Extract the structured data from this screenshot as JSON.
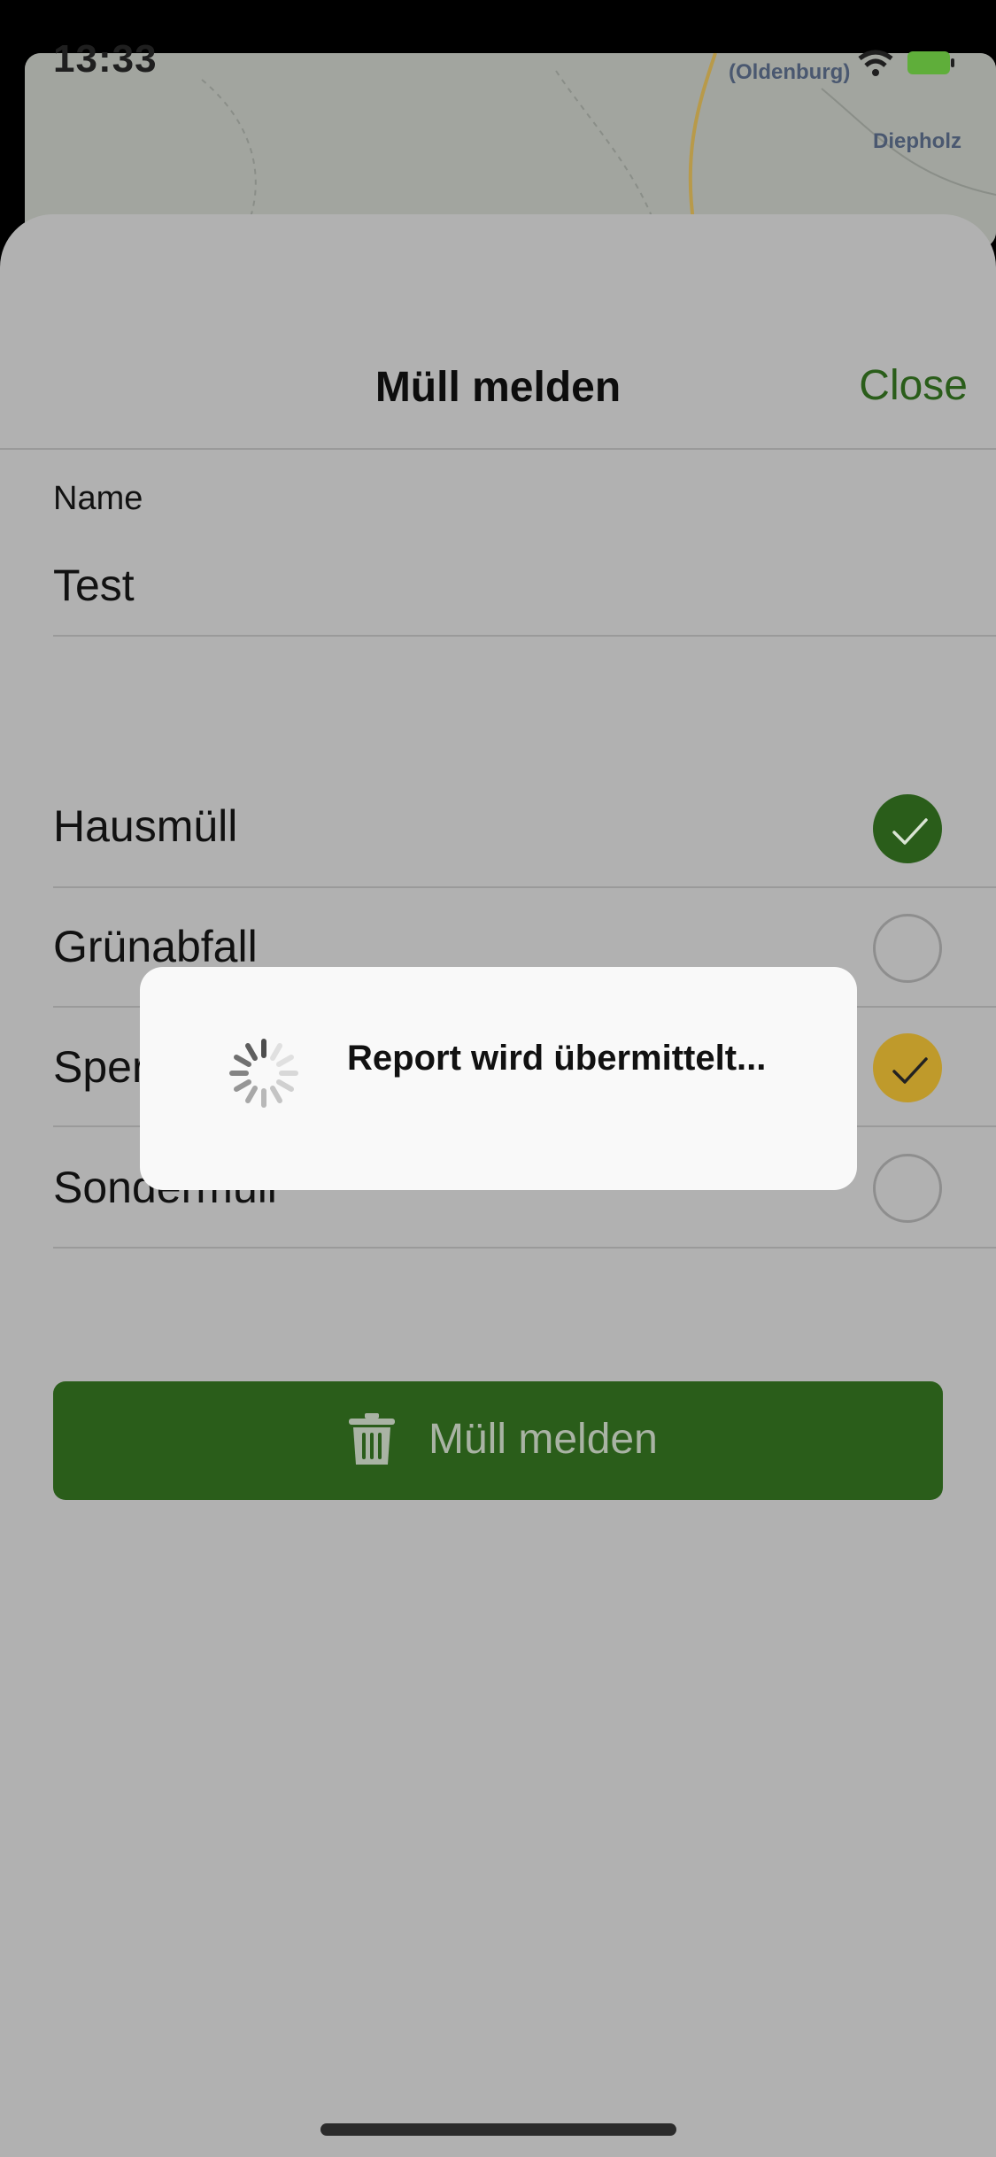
{
  "status_bar": {
    "time": "13:33"
  },
  "map": {
    "labels": [
      "(Oldenburg)",
      "Diepholz"
    ]
  },
  "sheet": {
    "title": "Müll melden",
    "close_label": "Close",
    "name_field": {
      "label": "Name",
      "value": "Test"
    },
    "options": [
      {
        "label": "Hausmüll",
        "selected": true,
        "color": "#2a5d1a"
      },
      {
        "label": "Grünabfall",
        "selected": false
      },
      {
        "label": "Sperrmüll",
        "selected": true,
        "color": "#bf9a2b"
      },
      {
        "label": "Sondermüll",
        "selected": false
      }
    ],
    "submit_label": "Müll melden"
  },
  "hud": {
    "message": "Report wird übermittelt..."
  },
  "colors": {
    "accent": "#2a5d1a",
    "highlight": "#bf9a2b",
    "overlay_sheet": "#b1b1b1"
  }
}
